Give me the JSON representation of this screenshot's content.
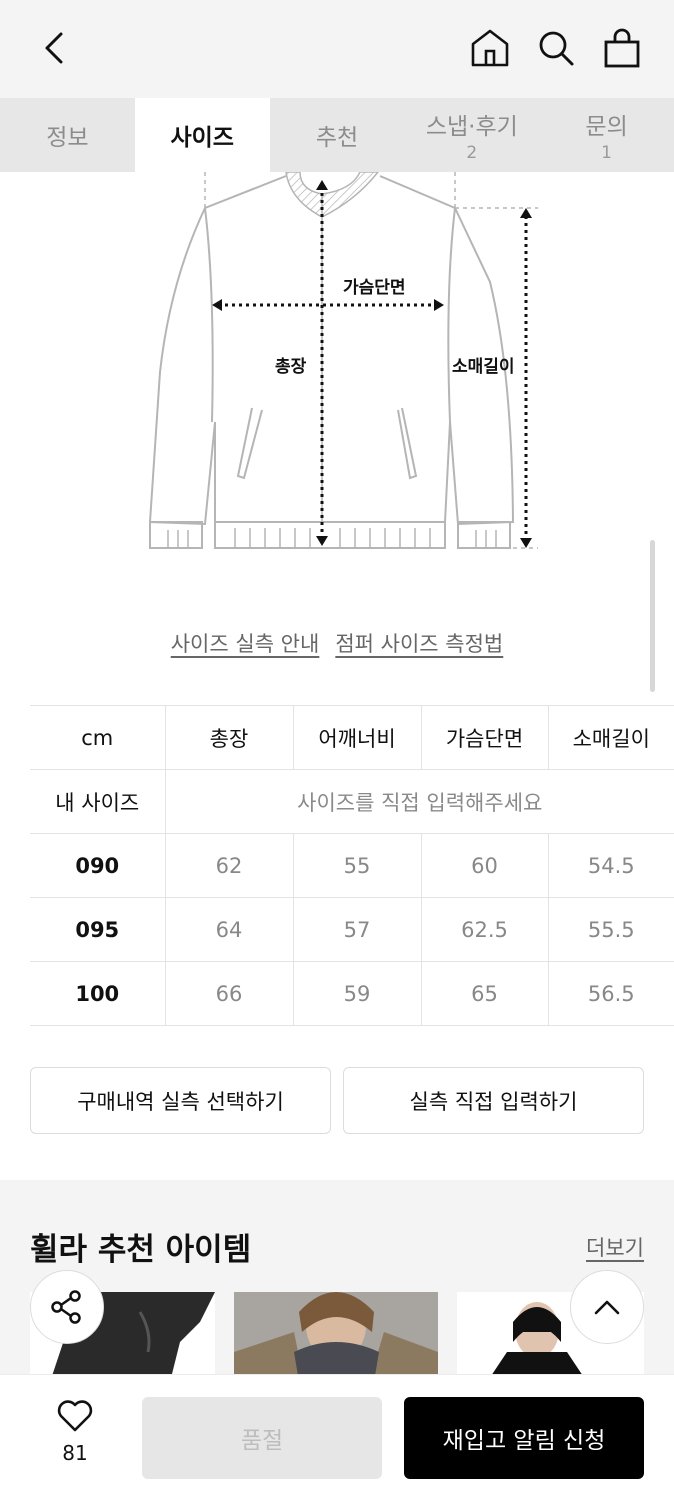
{
  "tabs": [
    {
      "label": "정보",
      "count": ""
    },
    {
      "label": "사이즈",
      "count": ""
    },
    {
      "label": "추천",
      "count": ""
    },
    {
      "label": "스냅·후기",
      "count": "2"
    },
    {
      "label": "문의",
      "count": "1"
    }
  ],
  "active_tab": "사이즈",
  "diagram": {
    "chest_label": "가슴단면",
    "length_label": "총장",
    "sleeve_label": "소매길이"
  },
  "links": {
    "size_guide": "사이즈 실측 안내",
    "measure_guide": "점퍼 사이즈 측정법"
  },
  "size_table": {
    "headers": [
      "cm",
      "총장",
      "어깨너비",
      "가슴단면",
      "소매길이"
    ],
    "my_size_label": "내 사이즈",
    "my_size_placeholder": "사이즈를 직접 입력해주세요",
    "rows": [
      {
        "size": "090",
        "values": [
          "62",
          "55",
          "60",
          "54.5"
        ]
      },
      {
        "size": "095",
        "values": [
          "64",
          "57",
          "62.5",
          "55.5"
        ]
      },
      {
        "size": "100",
        "values": [
          "66",
          "59",
          "65",
          "56.5"
        ]
      }
    ]
  },
  "buttons": {
    "purchase_history": "구매내역 실측 선택하기",
    "manual_input": "실측 직접 입력하기"
  },
  "recommend": {
    "title": "휠라 추천 아이템",
    "more": "더보기"
  },
  "bottom_bar": {
    "like_count": "81",
    "soldout_label": "품절",
    "restock_label": "재입고 알림 신청"
  },
  "colors": {
    "header_bg": "#f4f4f4",
    "tab_bg": "#e7e7e7",
    "primary_button": "#000000",
    "disabled_button": "#e6e6e6"
  },
  "icons": [
    "back-arrow-icon",
    "home-icon",
    "search-icon",
    "shopping-bag-icon",
    "share-icon",
    "chevron-up-icon",
    "heart-icon"
  ]
}
